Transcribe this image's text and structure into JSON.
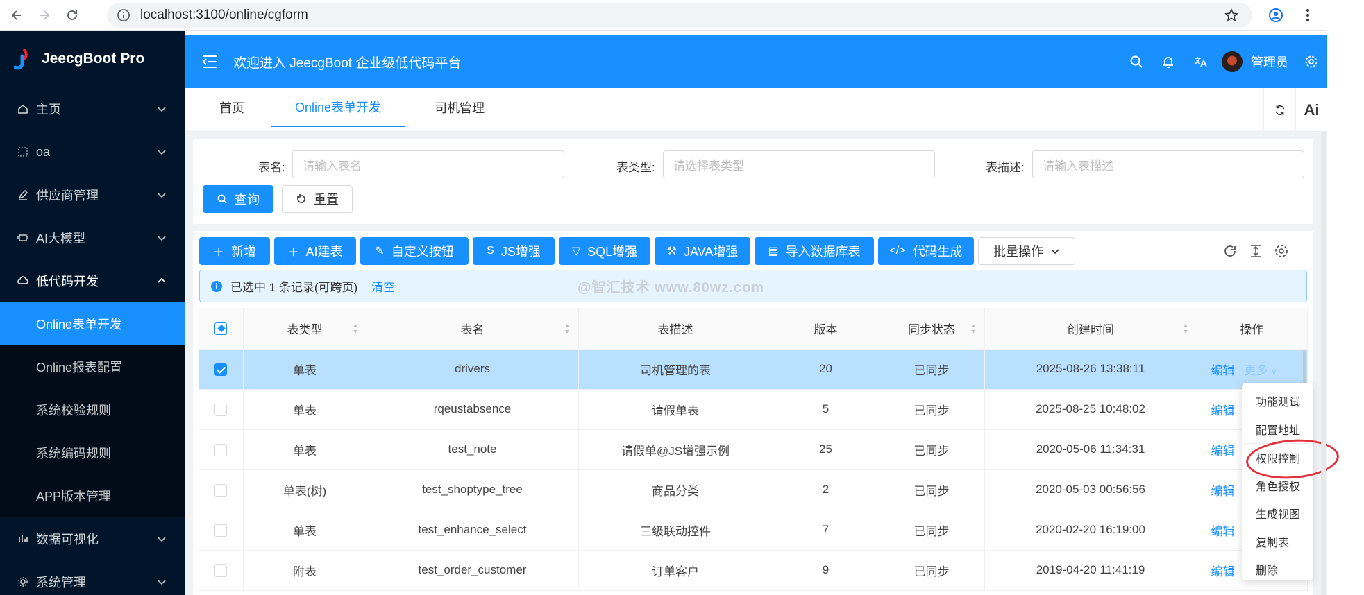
{
  "browser": {
    "url": "localhost:3100/online/cgform"
  },
  "sidebar": {
    "logo": "JeecgBoot Pro",
    "items": [
      {
        "label": "主页"
      },
      {
        "label": "oa"
      },
      {
        "label": "供应商管理"
      },
      {
        "label": "AI大模型"
      },
      {
        "label": "低代码开发"
      }
    ],
    "sub_items": [
      {
        "label": "Online表单开发"
      },
      {
        "label": "Online报表配置"
      },
      {
        "label": "系统校验规则"
      },
      {
        "label": "系统编码规则"
      },
      {
        "label": "APP版本管理"
      }
    ],
    "bottom_items": [
      {
        "label": "数据可视化"
      },
      {
        "label": "系统管理"
      }
    ]
  },
  "header": {
    "title": "欢迎进入 JeecgBoot 企业级低代码平台",
    "user": "管理员"
  },
  "tabs": [
    {
      "label": "首页"
    },
    {
      "label": "Online表单开发"
    },
    {
      "label": "司机管理"
    }
  ],
  "tab_tools": {
    "ai": "Ai"
  },
  "search": {
    "table_name_label": "表名:",
    "table_name_placeholder": "请输入表名",
    "table_type_label": "表类型:",
    "table_type_placeholder": "请选择表类型",
    "table_desc_label": "表描述:",
    "table_desc_placeholder": "请输入表描述",
    "query": "查询",
    "reset": "重置"
  },
  "toolbar": {
    "add": "新增",
    "ai_build": "AI建表",
    "custom_button": "自定义按钮",
    "js_enhance": "JS增强",
    "sql_enhance": "SQL增强",
    "java_enhance": "JAVA增强",
    "import_db": "导入数据库表",
    "code_gen": "代码生成",
    "batch": "批量操作"
  },
  "alert": {
    "text": "已选中 1 条记录(可跨页)",
    "clear": "清空"
  },
  "watermark": "@智汇技术 www.80wz.com",
  "table": {
    "headers": [
      "表类型",
      "表名",
      "表描述",
      "版本",
      "同步状态",
      "创建时间",
      "操作"
    ],
    "rows": [
      {
        "type": "单表",
        "name": "drivers",
        "desc": "司机管理的表",
        "version": "20",
        "status": "已同步",
        "created": "2025-08-26 13:38:11",
        "selected": true
      },
      {
        "type": "单表",
        "name": "rqeustabsence",
        "desc": "请假单表",
        "version": "5",
        "status": "已同步",
        "created": "2025-08-25 10:48:02",
        "selected": false
      },
      {
        "type": "单表",
        "name": "test_note",
        "desc": "请假单@JS增强示例",
        "version": "25",
        "status": "已同步",
        "created": "2020-05-06 11:34:31",
        "selected": false
      },
      {
        "type": "单表(树)",
        "name": "test_shoptype_tree",
        "desc": "商品分类",
        "version": "2",
        "status": "已同步",
        "created": "2020-05-03 00:56:56",
        "selected": false
      },
      {
        "type": "单表",
        "name": "test_enhance_select",
        "desc": "三级联动控件",
        "version": "7",
        "status": "已同步",
        "created": "2020-02-20 16:19:00",
        "selected": false
      },
      {
        "type": "附表",
        "name": "test_order_customer",
        "desc": "订单客户",
        "version": "9",
        "status": "已同步",
        "created": "2019-04-20 11:41:19",
        "selected": false
      }
    ],
    "edit": "编辑",
    "more": "更多"
  },
  "dropdown": [
    {
      "label": "功能测试"
    },
    {
      "label": "配置地址"
    },
    {
      "label": "权限控制"
    },
    {
      "label": "角色授权"
    },
    {
      "label": "生成视图"
    },
    {
      "label": "复制表"
    },
    {
      "label": "删除"
    }
  ],
  "colors": {
    "primary": "#1890ff",
    "sidebar": "#001529",
    "success": "#52c41a",
    "highlight_ring": "#e0323a"
  }
}
